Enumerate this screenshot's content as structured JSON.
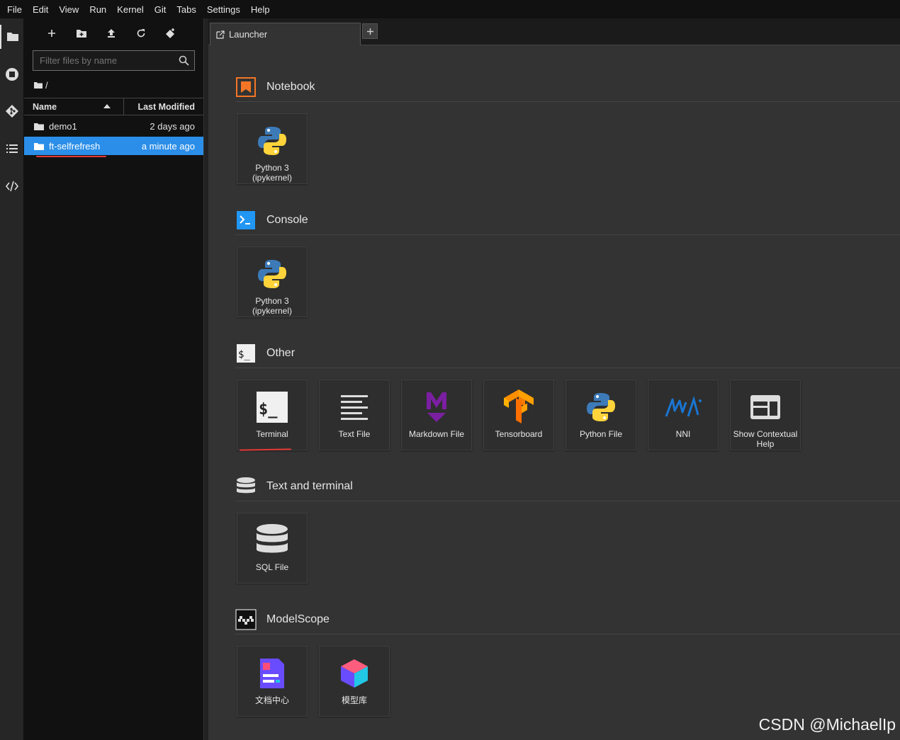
{
  "menu": [
    "File",
    "Edit",
    "View",
    "Run",
    "Kernel",
    "Git",
    "Tabs",
    "Settings",
    "Help"
  ],
  "activity": [
    "folder-icon",
    "running-icon",
    "git-icon",
    "toc-icon",
    "code-icon"
  ],
  "filebrowser": {
    "filter_placeholder": "Filter files by name",
    "breadcrumb": "/",
    "col_name": "Name",
    "col_modified": "Last Modified",
    "rows": [
      {
        "name": "demo1",
        "modified": "2 days ago"
      },
      {
        "name": "ft-selfrefresh",
        "modified": "a minute ago"
      }
    ]
  },
  "tabs": [
    {
      "label": "Launcher"
    }
  ],
  "launcher": {
    "sections": [
      {
        "title": "Notebook",
        "cards": [
          {
            "label": "Python 3\n(ipykernel)"
          }
        ]
      },
      {
        "title": "Console",
        "cards": [
          {
            "label": "Python 3\n(ipykernel)"
          }
        ]
      },
      {
        "title": "Other",
        "cards": [
          {
            "label": "Terminal"
          },
          {
            "label": "Text File"
          },
          {
            "label": "Markdown File"
          },
          {
            "label": "Tensorboard"
          },
          {
            "label": "Python File"
          },
          {
            "label": "NNI"
          },
          {
            "label": "Show Contextual\nHelp"
          }
        ]
      },
      {
        "title": "Text and terminal",
        "cards": [
          {
            "label": "SQL File"
          }
        ]
      },
      {
        "title": "ModelScope",
        "cards": [
          {
            "label": "文档中心"
          },
          {
            "label": "模型库"
          }
        ]
      }
    ]
  },
  "colors": {
    "accent": "#2b8ee8",
    "notebook_orange": "#f37626",
    "console_blue": "#2196f3",
    "underline_red": "#e53935"
  },
  "watermark": "CSDN @MichaelIp"
}
